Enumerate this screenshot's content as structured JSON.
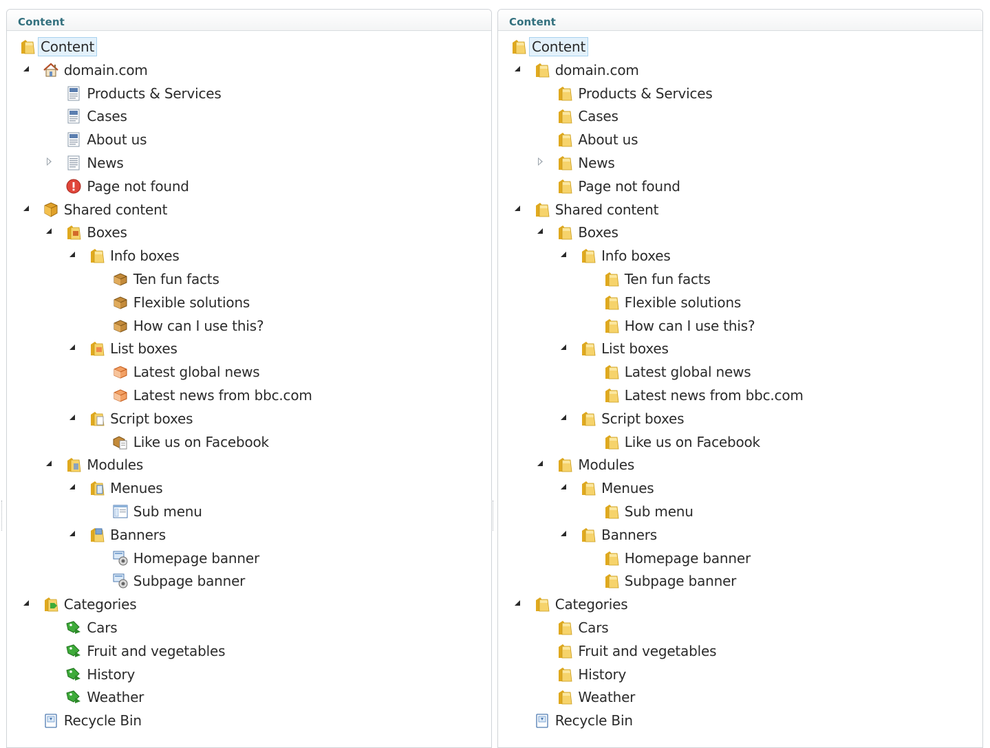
{
  "panels": [
    {
      "title": "Content",
      "icon_mode": "typed",
      "nodes": [
        {
          "label": "Content",
          "level": 0,
          "expander": "none",
          "icon": "folder-icon",
          "root": true
        },
        {
          "label": "domain.com",
          "level": 1,
          "expander": "open",
          "icon": "home-icon"
        },
        {
          "label": "Products & Services",
          "level": 2,
          "expander": "none",
          "icon": "page-icon"
        },
        {
          "label": "Cases",
          "level": 2,
          "expander": "none",
          "icon": "page-icon"
        },
        {
          "label": "About us",
          "level": 2,
          "expander": "none",
          "icon": "page-icon"
        },
        {
          "label": "News",
          "level": 2,
          "expander": "closed",
          "icon": "list-page-icon"
        },
        {
          "label": "Page not found",
          "level": 2,
          "expander": "none",
          "icon": "error-icon"
        },
        {
          "label": "Shared content",
          "level": 1,
          "expander": "open",
          "icon": "package-icon"
        },
        {
          "label": "Boxes",
          "level": 2,
          "expander": "open",
          "icon": "boxes-folder-icon"
        },
        {
          "label": "Info boxes",
          "level": 3,
          "expander": "open",
          "icon": "folder-icon"
        },
        {
          "label": "Ten fun facts",
          "level": 4,
          "expander": "none",
          "icon": "box-icon"
        },
        {
          "label": "Flexible solutions",
          "level": 4,
          "expander": "none",
          "icon": "box-icon"
        },
        {
          "label": "How can I use this?",
          "level": 4,
          "expander": "none",
          "icon": "box-icon"
        },
        {
          "label": "List boxes",
          "level": 3,
          "expander": "open",
          "icon": "list-folder-icon"
        },
        {
          "label": "Latest global news",
          "level": 4,
          "expander": "none",
          "icon": "feed-box-icon"
        },
        {
          "label": "Latest news from bbc.com",
          "level": 4,
          "expander": "none",
          "icon": "feed-box-icon"
        },
        {
          "label": "Script boxes",
          "level": 3,
          "expander": "open",
          "icon": "script-folder-icon"
        },
        {
          "label": "Like us on Facebook",
          "level": 4,
          "expander": "none",
          "icon": "script-box-icon"
        },
        {
          "label": "Modules",
          "level": 2,
          "expander": "open",
          "icon": "modules-folder-icon"
        },
        {
          "label": "Menues",
          "level": 3,
          "expander": "open",
          "icon": "menu-folder-icon"
        },
        {
          "label": "Sub menu",
          "level": 4,
          "expander": "none",
          "icon": "menu-icon"
        },
        {
          "label": "Banners",
          "level": 3,
          "expander": "open",
          "icon": "banner-folder-icon"
        },
        {
          "label": "Homepage banner",
          "level": 4,
          "expander": "none",
          "icon": "banner-icon"
        },
        {
          "label": "Subpage banner",
          "level": 4,
          "expander": "none",
          "icon": "banner-icon"
        },
        {
          "label": "Categories",
          "level": 1,
          "expander": "open",
          "icon": "category-folder-icon"
        },
        {
          "label": "Cars",
          "level": 2,
          "expander": "none",
          "icon": "tag-icon"
        },
        {
          "label": "Fruit and vegetables",
          "level": 2,
          "expander": "none",
          "icon": "tag-icon"
        },
        {
          "label": "History",
          "level": 2,
          "expander": "none",
          "icon": "tag-icon"
        },
        {
          "label": "Weather",
          "level": 2,
          "expander": "none",
          "icon": "tag-icon"
        },
        {
          "label": "Recycle Bin",
          "level": 1,
          "expander": "none",
          "icon": "recycle-bin-icon"
        }
      ]
    },
    {
      "title": "Content",
      "icon_mode": "folders",
      "nodes": [
        {
          "label": "Content",
          "level": 0,
          "expander": "none",
          "icon": "folder-icon",
          "root": true
        },
        {
          "label": "domain.com",
          "level": 1,
          "expander": "open",
          "icon": "folder-icon"
        },
        {
          "label": "Products & Services",
          "level": 2,
          "expander": "none",
          "icon": "folder-icon"
        },
        {
          "label": "Cases",
          "level": 2,
          "expander": "none",
          "icon": "folder-icon"
        },
        {
          "label": "About us",
          "level": 2,
          "expander": "none",
          "icon": "folder-icon"
        },
        {
          "label": "News",
          "level": 2,
          "expander": "closed",
          "icon": "folder-icon"
        },
        {
          "label": "Page not found",
          "level": 2,
          "expander": "none",
          "icon": "folder-icon"
        },
        {
          "label": "Shared content",
          "level": 1,
          "expander": "open",
          "icon": "folder-icon"
        },
        {
          "label": "Boxes",
          "level": 2,
          "expander": "open",
          "icon": "folder-icon"
        },
        {
          "label": "Info boxes",
          "level": 3,
          "expander": "open",
          "icon": "folder-icon"
        },
        {
          "label": "Ten fun facts",
          "level": 4,
          "expander": "none",
          "icon": "folder-icon"
        },
        {
          "label": "Flexible solutions",
          "level": 4,
          "expander": "none",
          "icon": "folder-icon"
        },
        {
          "label": "How can I use this?",
          "level": 4,
          "expander": "none",
          "icon": "folder-icon"
        },
        {
          "label": "List boxes",
          "level": 3,
          "expander": "open",
          "icon": "folder-icon"
        },
        {
          "label": "Latest global news",
          "level": 4,
          "expander": "none",
          "icon": "folder-icon"
        },
        {
          "label": "Latest news from bbc.com",
          "level": 4,
          "expander": "none",
          "icon": "folder-icon"
        },
        {
          "label": "Script boxes",
          "level": 3,
          "expander": "open",
          "icon": "folder-icon"
        },
        {
          "label": "Like us on Facebook",
          "level": 4,
          "expander": "none",
          "icon": "folder-icon"
        },
        {
          "label": "Modules",
          "level": 2,
          "expander": "open",
          "icon": "folder-icon"
        },
        {
          "label": "Menues",
          "level": 3,
          "expander": "open",
          "icon": "folder-icon"
        },
        {
          "label": "Sub menu",
          "level": 4,
          "expander": "none",
          "icon": "folder-icon"
        },
        {
          "label": "Banners",
          "level": 3,
          "expander": "open",
          "icon": "folder-icon"
        },
        {
          "label": "Homepage banner",
          "level": 4,
          "expander": "none",
          "icon": "folder-icon"
        },
        {
          "label": "Subpage banner",
          "level": 4,
          "expander": "none",
          "icon": "folder-icon"
        },
        {
          "label": "Categories",
          "level": 1,
          "expander": "open",
          "icon": "folder-icon"
        },
        {
          "label": "Cars",
          "level": 2,
          "expander": "none",
          "icon": "folder-icon"
        },
        {
          "label": "Fruit and vegetables",
          "level": 2,
          "expander": "none",
          "icon": "folder-icon"
        },
        {
          "label": "History",
          "level": 2,
          "expander": "none",
          "icon": "folder-icon"
        },
        {
          "label": "Weather",
          "level": 2,
          "expander": "none",
          "icon": "folder-icon"
        },
        {
          "label": "Recycle Bin",
          "level": 1,
          "expander": "none",
          "icon": "recycle-bin-icon"
        }
      ]
    }
  ],
  "colors": {
    "header_text": "#33707e",
    "selection_bg": "#e3f1fb",
    "selection_border": "#a8d2ef",
    "folder_yellow": "#f2c94c"
  }
}
